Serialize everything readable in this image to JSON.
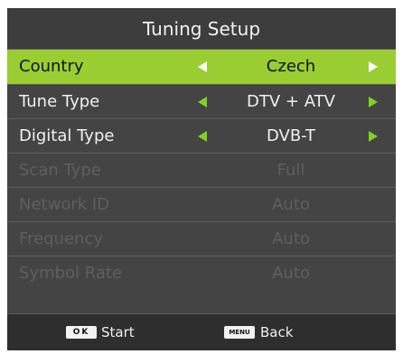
{
  "header": {
    "title": "Tuning Setup"
  },
  "rows": [
    {
      "label": "Country",
      "value": "Czech"
    },
    {
      "label": "Tune Type",
      "value": "DTV + ATV"
    },
    {
      "label": "Digital Type",
      "value": "DVB-T"
    },
    {
      "label": "Scan Type",
      "value": "Full"
    },
    {
      "label": "Network ID",
      "value": "Auto"
    },
    {
      "label": "Frequency",
      "value": "Auto"
    },
    {
      "label": "Symbol Rate",
      "value": "Auto"
    }
  ],
  "footer": {
    "ok_key": "OK",
    "start_label": "Start",
    "menu_key": "MENU",
    "back_label": "Back"
  },
  "colors": {
    "selected_row": "#9acd32",
    "arrow": "#7ed321",
    "disabled_text": "#5f5f5f"
  }
}
